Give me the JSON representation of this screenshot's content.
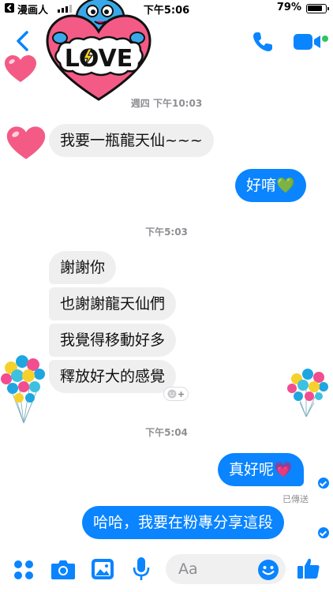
{
  "status_bar": {
    "app_name": "漫画人",
    "time": "下午5:06",
    "battery": "79%"
  },
  "sticker_text": "LOVE",
  "timestamps": {
    "first": "週四 下午10:03",
    "second": "下午5:03",
    "third": "下午5:04"
  },
  "messages": [
    {
      "side": "incoming",
      "text": "我要一瓶龍天仙~~~"
    },
    {
      "side": "outgoing",
      "text": "好唷💚"
    },
    {
      "side": "incoming",
      "text": "謝謝你"
    },
    {
      "side": "incoming",
      "text": "也謝謝龍天仙們"
    },
    {
      "side": "incoming",
      "text": "我覺得移動好多"
    },
    {
      "side": "incoming",
      "text": "釋放好大的感覺"
    },
    {
      "side": "outgoing",
      "text": "真好呢💗"
    },
    {
      "side": "outgoing",
      "text": "哈哈，我要在粉專分享這段"
    }
  ],
  "delivered_label": "已傳送",
  "composer": {
    "placeholder": "Aa"
  },
  "colors": {
    "accent": "#0a84ff",
    "incoming_bubble": "#efefef",
    "online": "#2fc55e",
    "heart": "#f35b86"
  }
}
